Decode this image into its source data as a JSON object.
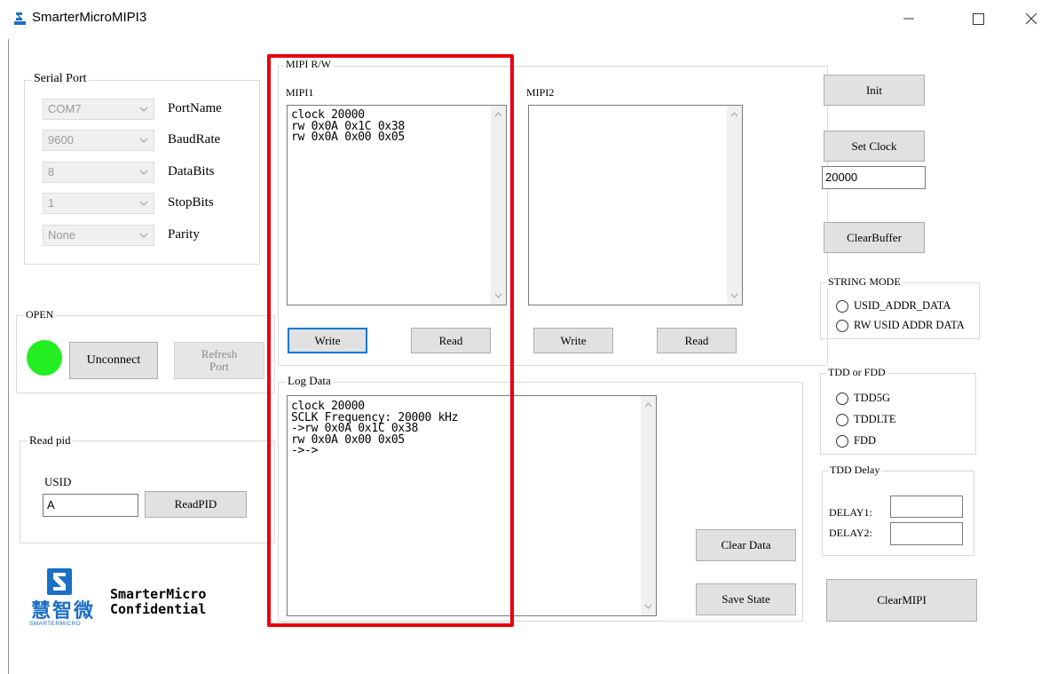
{
  "window": {
    "title": "SmarterMicroMIPI3",
    "app_icon": "smarter-micro-logo-icon"
  },
  "serial_port": {
    "title": "Serial Port",
    "rows": [
      {
        "value": "COM7",
        "label": "PortName"
      },
      {
        "value": "9600",
        "label": "BaudRate"
      },
      {
        "value": "8",
        "label": "DataBits"
      },
      {
        "value": "1",
        "label": "StopBits"
      },
      {
        "value": "None",
        "label": "Parity"
      }
    ]
  },
  "open": {
    "title": "OPEN",
    "status_color": "#22ee22",
    "unconnect_label": "Unconnect",
    "refresh_line1": "Refresh",
    "refresh_line2": "Port"
  },
  "read_pid": {
    "title": "Read pid",
    "usid_label": "USID",
    "usid_value": "A",
    "button_label": "ReadPID"
  },
  "brand": {
    "logo_text": "慧智微",
    "logo_sub": "SMARTERMICRO",
    "line1": "SmarterMicro",
    "line2": "Confidential"
  },
  "mipi_rw": {
    "title": "MIPI R/W",
    "mipi1": {
      "label": "MIPI1",
      "text": "clock 20000\nrw 0x0A 0x1C 0x38\nrw 0x0A 0x00 0x05",
      "write_label": "Write",
      "read_label": "Read"
    },
    "mipi2": {
      "label": "MIPI2",
      "text": "",
      "write_label": "Write",
      "read_label": "Read"
    }
  },
  "log_data": {
    "title": "Log Data",
    "text": "clock 20000\nSCLK Frequency: 20000 kHz\n->rw 0x0A 0x1C 0x38\nrw 0x0A 0x00 0x05\n->->",
    "clear_label": "Clear Data",
    "save_label": "Save State"
  },
  "right_panel": {
    "init_label": "Init",
    "set_clock_label": "Set Clock",
    "clock_value": "20000",
    "clear_buffer_label": "ClearBuffer",
    "string_mode": {
      "title": "STRING MODE",
      "options": [
        "USID_ADDR_DATA",
        "RW USID ADDR DATA"
      ]
    },
    "tdd_fdd": {
      "title": "TDD or FDD",
      "options": [
        "TDD5G",
        "TDDLTE",
        "FDD"
      ]
    },
    "tdd_delay": {
      "title": "TDD Delay",
      "delay1_label": "DELAY1:",
      "delay2_label": "DELAY2:",
      "delay1_value": "",
      "delay2_value": ""
    },
    "clear_mipi_label": "ClearMIPI"
  },
  "colors": {
    "highlight": "#e8000b",
    "focus": "#0078d7",
    "logo_blue": "#1a6fc4"
  }
}
